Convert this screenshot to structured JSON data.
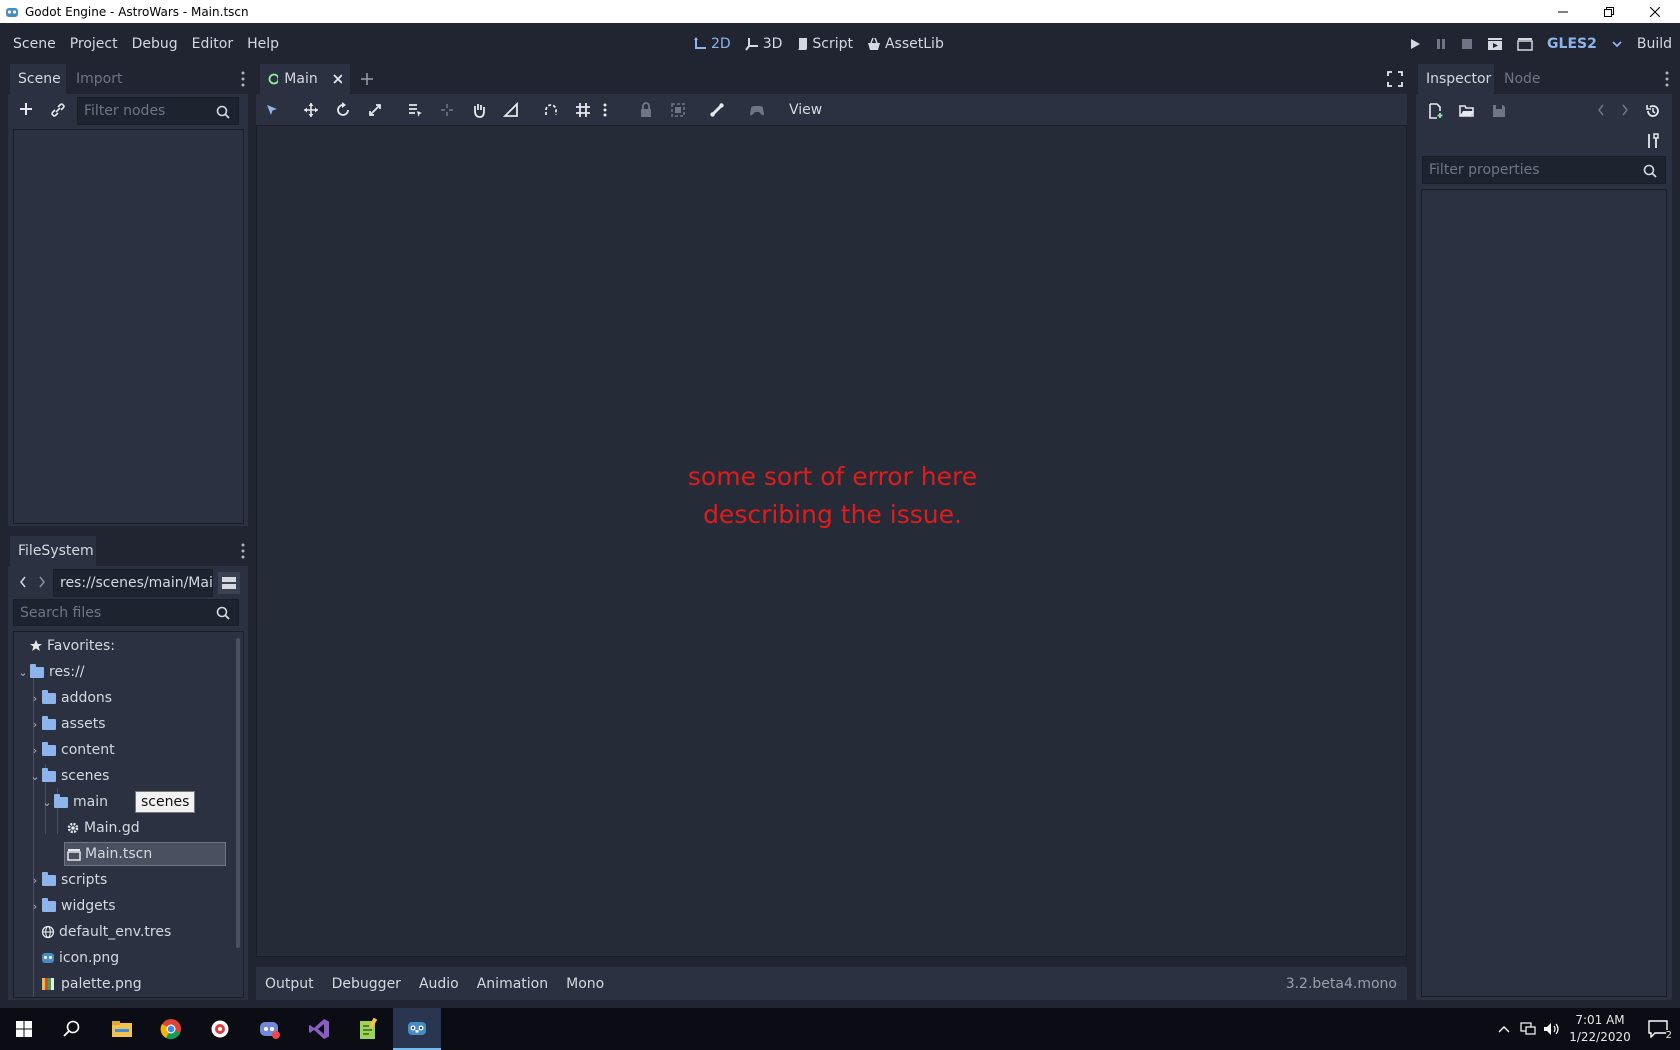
{
  "window": {
    "title": "Godot Engine - AstroWars - Main.tscn"
  },
  "menu": {
    "items": [
      "Scene",
      "Project",
      "Debug",
      "Editor",
      "Help"
    ]
  },
  "workspaces": {
    "items": [
      {
        "label": "2D",
        "active": true
      },
      {
        "label": "3D",
        "active": false
      },
      {
        "label": "Script",
        "active": false
      },
      {
        "label": "AssetLib",
        "active": false
      }
    ]
  },
  "run": {
    "renderer": "GLES2",
    "build_label": "Build"
  },
  "scene_dock": {
    "tabs": [
      "Scene",
      "Import"
    ],
    "filter_placeholder": "Filter nodes"
  },
  "filesystem_dock": {
    "tab": "FileSystem",
    "path": "res://scenes/main/Mai",
    "search_placeholder": "Search files",
    "tooltip": "scenes",
    "favorites_label": "Favorites:",
    "tree": [
      {
        "label": "res://",
        "type": "folder",
        "expanded": true
      },
      {
        "label": "addons",
        "type": "folder",
        "expanded": false
      },
      {
        "label": "assets",
        "type": "folder",
        "expanded": false
      },
      {
        "label": "content",
        "type": "folder",
        "expanded": false
      },
      {
        "label": "scenes",
        "type": "folder",
        "expanded": true
      },
      {
        "label": "main",
        "type": "folder",
        "expanded": true
      },
      {
        "label": "Main.gd",
        "type": "script"
      },
      {
        "label": "Main.tscn",
        "type": "scene",
        "selected": true
      },
      {
        "label": "scripts",
        "type": "folder",
        "expanded": false
      },
      {
        "label": "widgets",
        "type": "folder",
        "expanded": false
      },
      {
        "label": "default_env.tres",
        "type": "resource"
      },
      {
        "label": "icon.png",
        "type": "image"
      },
      {
        "label": "palette.png",
        "type": "image"
      }
    ]
  },
  "editor": {
    "scene_tab": "Main",
    "view_menu": "View",
    "error_line1": "some sort of error here",
    "error_line2": "describing the issue."
  },
  "bottom_panel": {
    "items": [
      "Output",
      "Debugger",
      "Audio",
      "Animation",
      "Mono"
    ],
    "version": "3.2.beta4.mono"
  },
  "inspector": {
    "tabs": [
      "Inspector",
      "Node"
    ],
    "filter_placeholder": "Filter properties"
  },
  "taskbar": {
    "time": "7:01 AM",
    "date": "1/22/2020",
    "notifications": "2"
  },
  "colors": {
    "accent": "#8eb4ec",
    "error": "#e01b1b",
    "panel": "#2b3140",
    "background": "#202531"
  }
}
